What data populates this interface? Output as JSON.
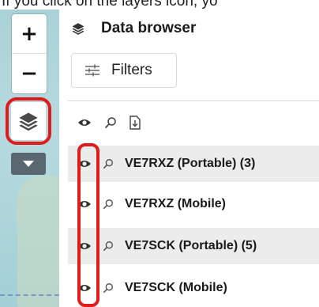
{
  "caption": "If you click on the layers icon, yo",
  "map_controls": {
    "zoom_in": "+",
    "zoom_out": "−",
    "layers_icon": "layers-icon",
    "dropdown_icon": "caret-down-icon"
  },
  "panel": {
    "title": "Data browser",
    "title_icon": "layers-icon",
    "filters_label": "Filters",
    "filters_icon": "sliders-icon",
    "toolbar_icons": [
      "eye-icon",
      "zoom-icon",
      "export-icon"
    ]
  },
  "rows": [
    {
      "label": "VE7RXZ (Portable)  (3)",
      "shaded": true
    },
    {
      "label": "VE7RXZ (Mobile)",
      "shaded": false
    },
    {
      "label": "VE7SCK (Portable)  (5)",
      "shaded": true
    },
    {
      "label": "VE7SCK (Mobile)",
      "shaded": false
    }
  ],
  "colors": {
    "highlight": "#e01b1b",
    "row_shade": "#ececec",
    "map_water": "#aad3d9",
    "dropdown_bg": "#5a6670"
  }
}
